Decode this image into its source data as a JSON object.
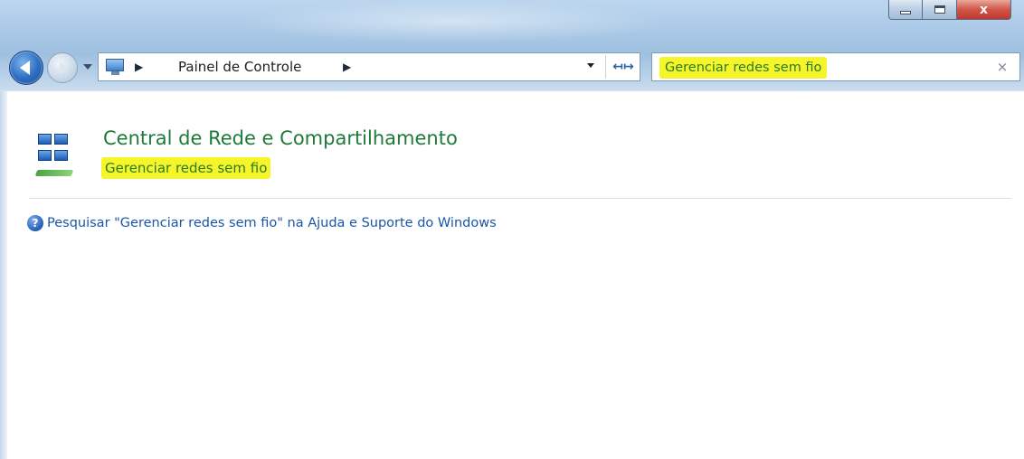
{
  "window": {
    "caption_buttons": {
      "minimize_icon": "minimize-icon",
      "maximize_icon": "maximize-icon",
      "close_glyph": "x"
    }
  },
  "navigation": {
    "back_icon": "back-arrow-icon",
    "forward_icon": "forward-arrow-icon",
    "address": {
      "icon": "control-panel-icon",
      "separator": "▶",
      "path": "Painel de Controle",
      "refresh_glyph": "↤↦"
    },
    "search": {
      "value": "Gerenciar redes sem fio",
      "clear_glyph": "×",
      "highlight_color": "#f5f52a"
    }
  },
  "results": {
    "items": [
      {
        "icon": "network-sharing-center-icon",
        "title": "Central de Rede e Compartilhamento",
        "subtitle": "Gerenciar redes sem fio"
      }
    ],
    "help_link": {
      "icon": "help-icon",
      "icon_glyph": "?",
      "text": "Pesquisar \"Gerenciar redes sem fio\" na Ajuda e Suporte do Windows"
    }
  },
  "colors": {
    "title_green": "#1f7a3a",
    "link_blue": "#1a56a6",
    "highlight_yellow": "#f5f52a"
  }
}
